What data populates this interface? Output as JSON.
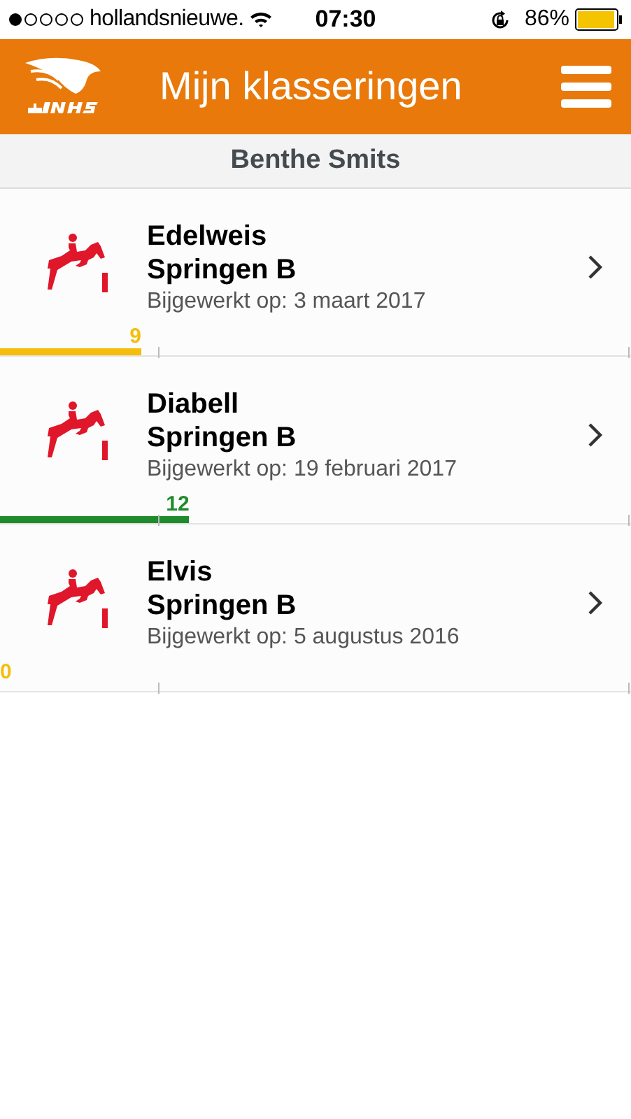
{
  "status_bar": {
    "carrier": "hollandsnieuwe.",
    "time": "07:30",
    "battery": "86%"
  },
  "header": {
    "title": "Mijn klasseringen"
  },
  "rider": {
    "name": "Benthe Smits"
  },
  "rankings": [
    {
      "horse": "Edelweis",
      "discipline": "Springen B",
      "updated": "Bijgewerkt op: 3 maart 2017",
      "score": "9",
      "level": 0.224,
      "color": "#f5be0b"
    },
    {
      "horse": "Diabell",
      "discipline": "Springen B",
      "updated": "Bijgewerkt op: 19 februari 2017",
      "score": "12",
      "level": 0.3,
      "color": "#1f8b2c"
    },
    {
      "horse": "Elvis",
      "discipline": "Springen B",
      "updated": "Bijgewerkt op: 5 augustus 2016",
      "score": "0",
      "level": 0,
      "color": "#f5be0b"
    }
  ]
}
